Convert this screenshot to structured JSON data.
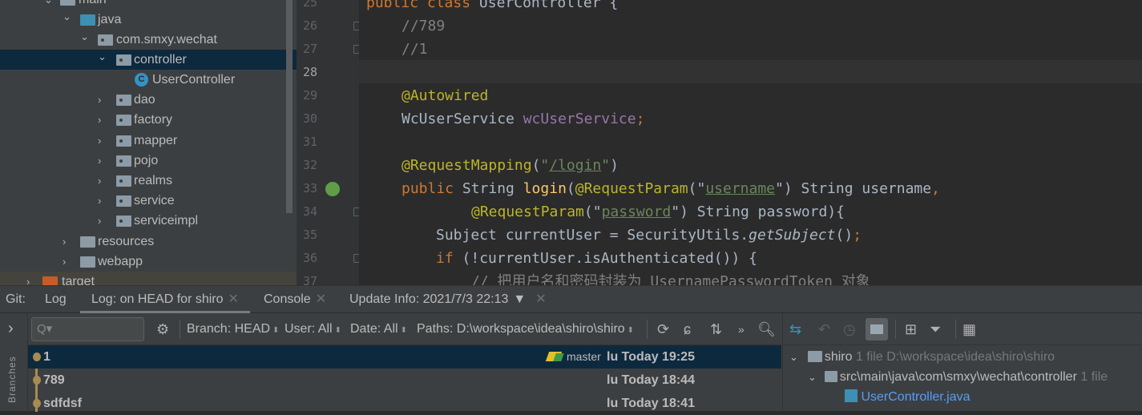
{
  "project_tree": {
    "items": [
      {
        "label": "main",
        "expanded": true
      },
      {
        "label": "java",
        "expanded": true
      },
      {
        "label": "com.smxy.wechat",
        "expanded": true
      },
      {
        "label": "controller",
        "expanded": true,
        "selected": true
      },
      {
        "label": "UserController",
        "type": "class"
      },
      {
        "label": "dao"
      },
      {
        "label": "factory"
      },
      {
        "label": "mapper"
      },
      {
        "label": "pojo"
      },
      {
        "label": "realms"
      },
      {
        "label": "service"
      },
      {
        "label": "serviceimpl"
      },
      {
        "label": "resources"
      },
      {
        "label": "webapp"
      },
      {
        "label": "target"
      }
    ]
  },
  "editor": {
    "current_line": "28",
    "lines": [
      {
        "n": "25"
      },
      {
        "n": "26"
      },
      {
        "n": "27"
      },
      {
        "n": "28"
      },
      {
        "n": "29"
      },
      {
        "n": "30"
      },
      {
        "n": "31"
      },
      {
        "n": "32"
      },
      {
        "n": "33"
      },
      {
        "n": "34"
      },
      {
        "n": "35"
      },
      {
        "n": "36"
      },
      {
        "n": "37"
      }
    ],
    "code": {
      "l25a": "public class ",
      "l25b": "UserController {",
      "l26": "//789",
      "l27": "//1",
      "l29": "@Autowired",
      "l30a": "WcUserService ",
      "l30b": "wcUserService",
      ";": ";",
      "l32a": "@RequestMapping",
      "l32b": "(",
      "l32c": "\"",
      "l32d": "/login",
      "l32e": "\"",
      "l32f": ")",
      "l33a": "public ",
      "l33b": "String ",
      "l33c": "login",
      "l33d": "(",
      "l33e": "@RequestParam",
      "l33f": "(\"",
      "l33g": "username",
      "l33h": "\") String username",
      ",": ",",
      "l34a": "@RequestParam",
      "l34b": "(\"",
      "l34c": "password",
      "l34d": "\") String password){",
      "l35a": "Subject currentUser = SecurityUtils.",
      "l35b": "getSubject",
      "l35c": "()",
      "l36a": "if ",
      "l36b": "(!currentUser.isAuthenticated()) {",
      "l37": "// 把用户名和密码封装为 UsernamePasswordToken 对象"
    }
  },
  "bottom": {
    "tabs": {
      "git": "Git:",
      "log": "Log",
      "log_head": "Log: on HEAD for shiro",
      "console": "Console",
      "update": "Update Info: 2021/7/3 22:13"
    },
    "sidebar_label": "Branches",
    "toolbar": {
      "search_placeholder": "Q▾",
      "branch": "Branch: HEAD",
      "user": "User: All",
      "date": "Date: All",
      "paths": "Paths: D:\\workspace\\idea\\shiro\\shiro"
    },
    "commits": [
      {
        "message": "1",
        "author": "lu",
        "date": "Today 19:25",
        "branch": "master",
        "selected": true
      },
      {
        "message": "789",
        "author": "lu",
        "date": "Today 18:44"
      },
      {
        "message": "sdfdsf",
        "author": "lu",
        "date": "Today 18:41"
      }
    ],
    "changes": {
      "root": "shiro",
      "root_count": "1 file",
      "root_path": "D:\\workspace\\idea\\shiro\\shiro",
      "dir": "src\\main\\java\\com\\smxy\\wechat\\controller",
      "dir_count": "1 file",
      "file": "UserController.java"
    }
  },
  "colors": {
    "selection": "#0d293e",
    "keyword": "#cc7832",
    "annotation": "#bbb529",
    "string": "#6a8759",
    "graph": "#a78b50"
  }
}
